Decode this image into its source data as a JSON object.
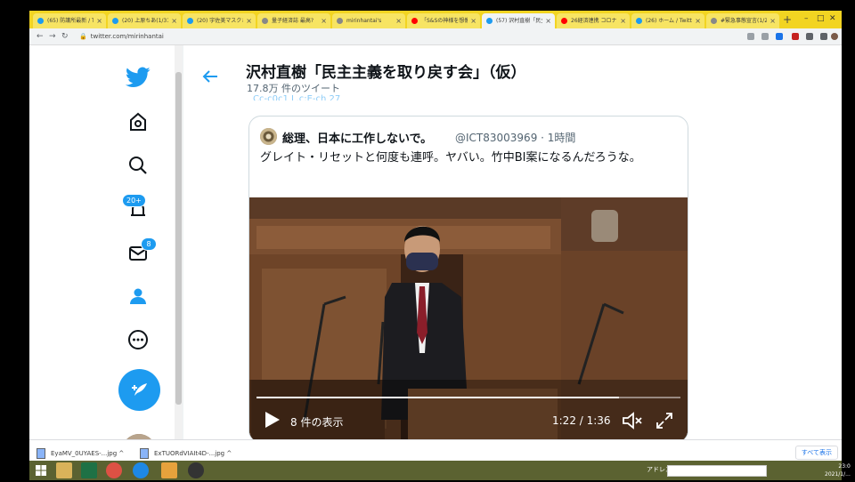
{
  "browser": {
    "tabs": [
      {
        "title": "(65) 防護所最新 / Twitter",
        "favicon": "twitter",
        "active": false
      },
      {
        "title": "(20) 上原ちあ(1/31の...",
        "favicon": "twitter",
        "active": false
      },
      {
        "title": "(20) 宇佐美マスクさん...",
        "favicon": "twitter",
        "active": false
      },
      {
        "title": "量子経済誌 最高?",
        "favicon": "generic",
        "active": false
      },
      {
        "title": "mirinhantai's",
        "favicon": "generic",
        "active": false
      },
      {
        "title": "「S&Sの神様を想像...",
        "favicon": "youtube",
        "active": false
      },
      {
        "title": "(57) 沢村直樹「民主...",
        "favicon": "twitter",
        "active": true
      },
      {
        "title": "26経済連携 コロナ...",
        "favicon": "youtube",
        "active": false
      },
      {
        "title": "(26) ホーム / Twitter",
        "favicon": "twitter",
        "active": false
      },
      {
        "title": "#緊急事態宣言(1/2...",
        "favicon": "generic",
        "active": false
      }
    ],
    "new_tab": "+",
    "url": "twitter.com/mirinhantai",
    "colors": {
      "tabbar": "#f2d422",
      "accent": "#1d9bf0"
    }
  },
  "nav": {
    "items": [
      {
        "name": "twitter-logo-icon"
      },
      {
        "name": "home-icon"
      },
      {
        "name": "explore-icon"
      },
      {
        "name": "notifications-icon",
        "badge": "20+"
      },
      {
        "name": "messages-icon",
        "badge": "8"
      },
      {
        "name": "profile-icon"
      },
      {
        "name": "more-icon"
      }
    ],
    "tweet_button": "compose-tweet-icon"
  },
  "header": {
    "back": "←",
    "profile_name": "沢村直樹「民主主義を取り戻す会」（仮）",
    "tweet_count": "17.8万 件のツイート",
    "cut_text": "Cc-c0c1 L.c:E-ch 27"
  },
  "quote_tweet": {
    "author_name": "総理、日本に工作しないで。",
    "handle_time": "@ICT83003969 · 1時間",
    "text": "グレイト・リセットと何度も連呼。ヤバい。竹中BI案になるんだろうな。",
    "video": {
      "views": "8 件の表示",
      "time": "1:22 / 1:36",
      "progress": 0.854
    }
  },
  "downloads": {
    "items": [
      {
        "name": "EyaMV_0UYAES-...jpg"
      },
      {
        "name": "ExTUORdVIAIt4D-...jpg"
      }
    ],
    "show_all": "すべて表示"
  },
  "taskbar": {
    "address_label": "アドレス",
    "time": "23:0",
    "date": "2021/1/..."
  }
}
